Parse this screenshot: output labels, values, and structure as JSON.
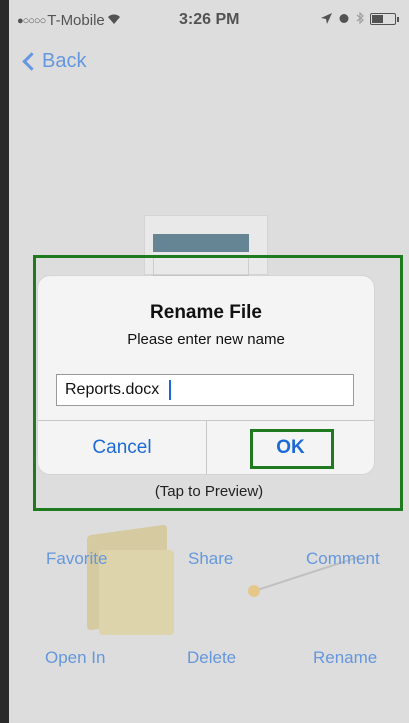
{
  "status_bar": {
    "carrier": "T-Mobile",
    "signal_dots": "●○○○○",
    "time": "3:26 PM"
  },
  "nav": {
    "back_label": "Back"
  },
  "dialog": {
    "title": "Rename File",
    "message": "Please enter new name",
    "input_value": "Reports.docx",
    "cancel_label": "Cancel",
    "ok_label": "OK"
  },
  "preview_hint": "(Tap to Preview)",
  "actions": {
    "favorite": "Favorite",
    "share": "Share",
    "comment": "Comment",
    "open_in": "Open In",
    "delete": "Delete",
    "rename": "Rename"
  },
  "colors": {
    "accent": "#1d6ad6",
    "highlight": "#1f7a1f"
  }
}
